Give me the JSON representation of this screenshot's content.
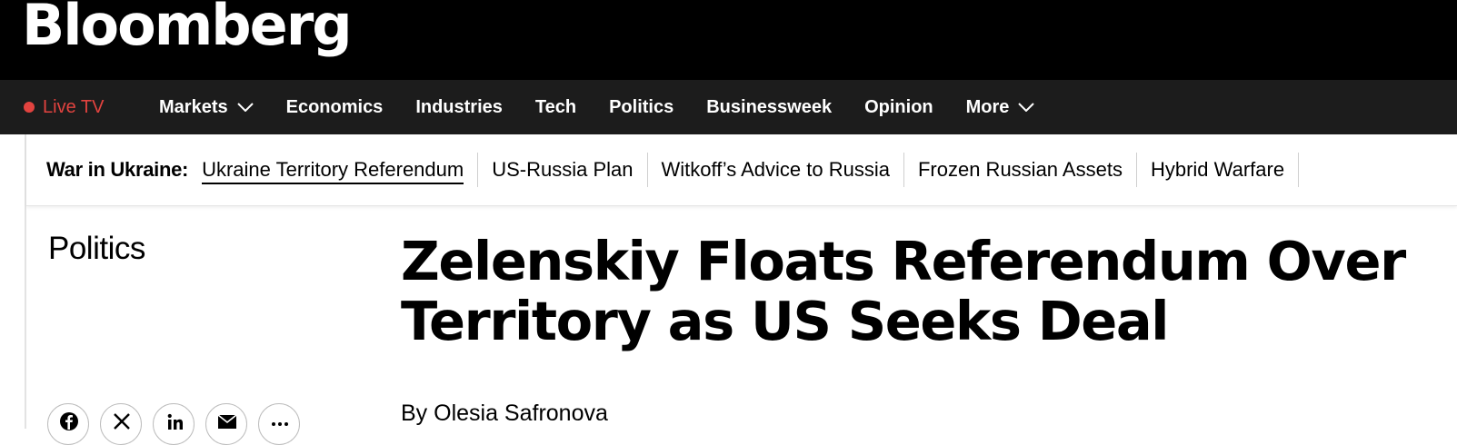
{
  "header": {
    "logo": "Bloomberg"
  },
  "nav": {
    "live_tv": "Live TV",
    "items": [
      {
        "label": "Markets",
        "has_dropdown": true
      },
      {
        "label": "Economics",
        "has_dropdown": false
      },
      {
        "label": "Industries",
        "has_dropdown": false
      },
      {
        "label": "Tech",
        "has_dropdown": false
      },
      {
        "label": "Politics",
        "has_dropdown": false
      },
      {
        "label": "Businessweek",
        "has_dropdown": false
      },
      {
        "label": "Opinion",
        "has_dropdown": false
      },
      {
        "label": "More",
        "has_dropdown": true
      }
    ]
  },
  "subnav": {
    "label": "War in Ukraine:",
    "links": [
      "Ukraine Territory Referendum",
      "US-Russia Plan",
      "Witkoff’s Advice to Russia",
      "Frozen Russian Assets",
      "Hybrid Warfare"
    ]
  },
  "article": {
    "section": "Politics",
    "headline_line1": "Zelenskiy Floats Referendum Over",
    "headline_line2": "Territory as US Seeks Deal",
    "byline": "By Olesia Safronova"
  },
  "share": {
    "icons": [
      "facebook-icon",
      "x-icon",
      "linkedin-icon",
      "email-icon",
      "more-icon"
    ]
  },
  "colors": {
    "live": "#e2433f",
    "topbar": "#000000",
    "navbar": "#1c1c1c"
  }
}
